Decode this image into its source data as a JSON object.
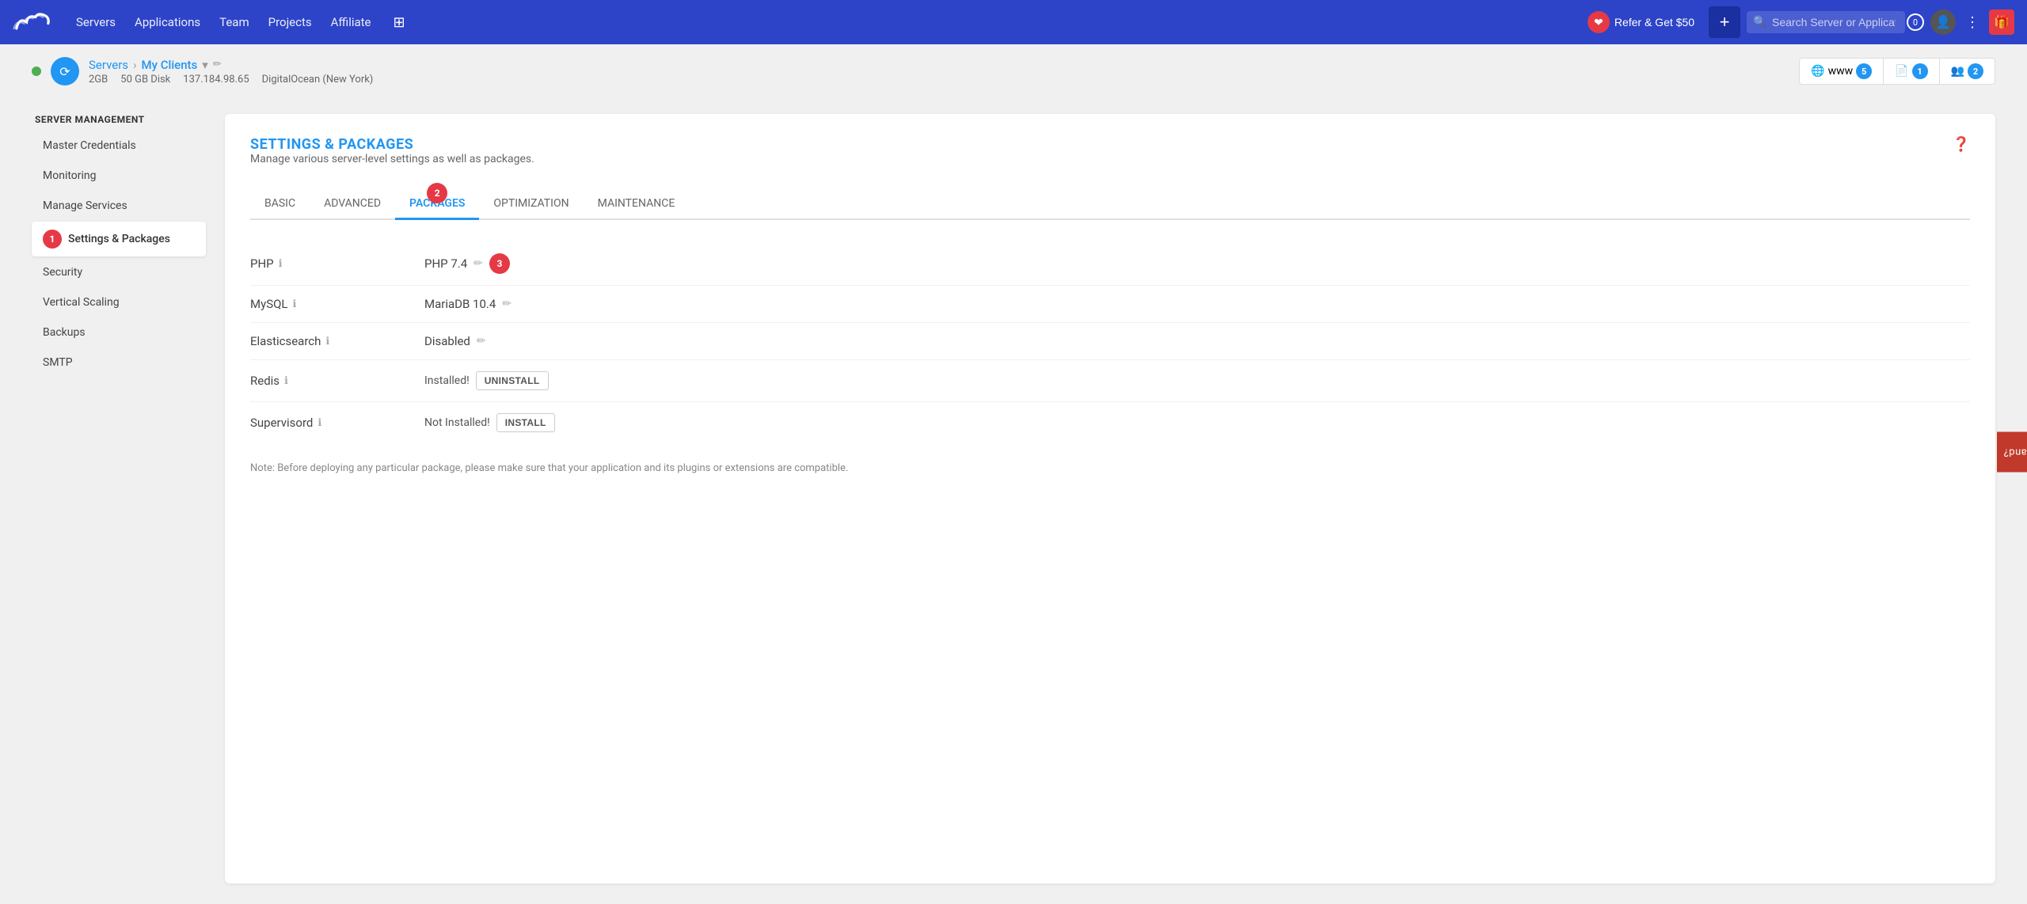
{
  "nav": {
    "links": [
      "Servers",
      "Applications",
      "Team",
      "Projects",
      "Affiliate"
    ],
    "refer_label": "Refer & Get $50",
    "search_placeholder": "Search Server or Application",
    "notif_count": "0"
  },
  "breadcrumb": {
    "servers_label": "Servers",
    "server_name": "My Clients",
    "ram": "2GB",
    "disk": "50 GB Disk",
    "ip": "137.184.98.65",
    "provider": "DigitalOcean (New York)",
    "stats": [
      {
        "icon": "www",
        "count": "5"
      },
      {
        "icon": "file",
        "count": "1"
      },
      {
        "icon": "users",
        "count": "2"
      }
    ]
  },
  "sidebar": {
    "section_title": "Server Management",
    "items": [
      {
        "label": "Master Credentials",
        "active": false
      },
      {
        "label": "Monitoring",
        "active": false
      },
      {
        "label": "Manage Services",
        "active": false
      },
      {
        "label": "Settings & Packages",
        "active": true
      },
      {
        "label": "Security",
        "active": false
      },
      {
        "label": "Vertical Scaling",
        "active": false
      },
      {
        "label": "Backups",
        "active": false
      },
      {
        "label": "SMTP",
        "active": false
      }
    ],
    "active_step": "1"
  },
  "panel": {
    "title": "SETTINGS & PACKAGES",
    "description": "Manage various server-level settings as well as packages.",
    "tabs": [
      {
        "label": "BASIC",
        "active": false
      },
      {
        "label": "ADVANCED",
        "active": false
      },
      {
        "label": "PACKAGES",
        "active": true,
        "step": "2"
      },
      {
        "label": "OPTIMIZATION",
        "active": false
      },
      {
        "label": "MAINTENANCE",
        "active": false
      }
    ],
    "packages": [
      {
        "name": "PHP",
        "value": "PHP 7.4",
        "has_edit": true,
        "status": "",
        "action": "",
        "step": "3"
      },
      {
        "name": "MySQL",
        "value": "MariaDB 10.4",
        "has_edit": true,
        "status": "",
        "action": ""
      },
      {
        "name": "Elasticsearch",
        "value": "Disabled",
        "has_edit": true,
        "status": "",
        "action": ""
      },
      {
        "name": "Redis",
        "value": "",
        "has_edit": false,
        "status": "Installed!",
        "action": "UNINSTALL"
      },
      {
        "name": "Supervisord",
        "value": "",
        "has_edit": false,
        "status": "Not Installed!",
        "action": "INSTALL"
      }
    ],
    "note": "Note: Before deploying any particular package, please make sure that your application and its plugins or extensions are compatible."
  },
  "feedback": {
    "label": "Need a hand?"
  }
}
